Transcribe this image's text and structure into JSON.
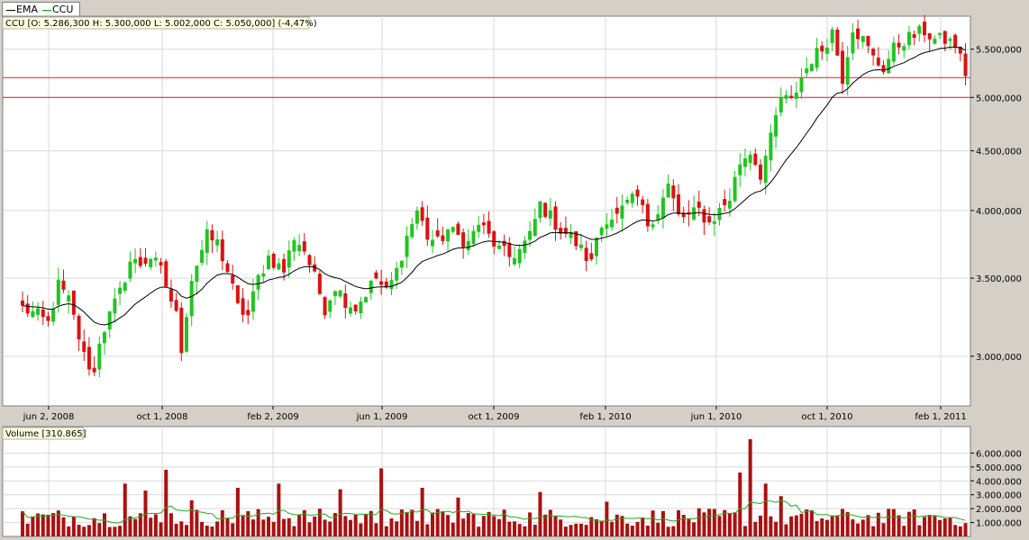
{
  "legend": {
    "items": [
      {
        "label": "EMA",
        "color": "#000000"
      },
      {
        "label": "CCU",
        "color": "#00b000"
      }
    ]
  },
  "price_panel": {
    "info": "CCU [O: 5.286,300  H: 5.300,000  L: 5.002,000  C: 5.050,000] (-4,47%)"
  },
  "volume_panel": {
    "info": "Volume [310.865]"
  },
  "colors": {
    "up": "#22c422",
    "down": "#dd1111",
    "ema": "#000000",
    "volume_bar": "#aa1111",
    "volume_ma": "#22aa22",
    "hline": "#dd2222",
    "grid": "#d9d9d9",
    "panel_bg": "#ffffff"
  },
  "chart_data": [
    {
      "type": "candlestick",
      "name": "CCU",
      "x_tick_labels": [
        "jun 2, 2008",
        "oct 1, 2008",
        "feb 2, 2009",
        "jun 1, 2009",
        "oct 1, 2009",
        "feb 1, 2010",
        "jun 1, 2010",
        "oct 1, 2010",
        "feb 1, 2011"
      ],
      "y_tick_labels": [
        "3.000,000",
        "3.500,000",
        "4.000,000",
        "4.500,000",
        "5.000,000",
        "5.500,000"
      ],
      "y_ticks": [
        3000000,
        3500000,
        4000000,
        4500000,
        5000000,
        5500000
      ],
      "y_scale": "log",
      "ylim": [
        2720000,
        5870000
      ],
      "horizontal_lines": [
        5200000,
        5000000
      ],
      "close_keyframes": [
        [
          0,
          3300000
        ],
        [
          3,
          3250000
        ],
        [
          5,
          3200000
        ],
        [
          7,
          3450000
        ],
        [
          9,
          3350000
        ],
        [
          12,
          3000000
        ],
        [
          14,
          2900000
        ],
        [
          15,
          3100000
        ],
        [
          17,
          3250000
        ],
        [
          19,
          3400000
        ],
        [
          21,
          3620000
        ],
        [
          23,
          3600000
        ],
        [
          25,
          3650000
        ],
        [
          27,
          3550000
        ],
        [
          30,
          3250000
        ],
        [
          31,
          3050000
        ],
        [
          33,
          3500000
        ],
        [
          36,
          3800000
        ],
        [
          38,
          3750000
        ],
        [
          40,
          3550000
        ],
        [
          42,
          3300000
        ],
        [
          44,
          3250000
        ],
        [
          46,
          3500000
        ],
        [
          48,
          3650000
        ],
        [
          51,
          3550000
        ],
        [
          53,
          3800000
        ],
        [
          55,
          3700000
        ],
        [
          57,
          3500000
        ],
        [
          59,
          3300000
        ],
        [
          61,
          3450000
        ],
        [
          63,
          3350000
        ],
        [
          65,
          3300000
        ],
        [
          67,
          3400000
        ],
        [
          69,
          3500000
        ],
        [
          71,
          3400000
        ],
        [
          73,
          3550000
        ],
        [
          75,
          3800000
        ],
        [
          77,
          4000000
        ],
        [
          79,
          3800000
        ],
        [
          81,
          3750000
        ],
        [
          83,
          3850000
        ],
        [
          85,
          3800000
        ],
        [
          87,
          3750000
        ],
        [
          89,
          3900000
        ],
        [
          91,
          3800000
        ],
        [
          93,
          3700000
        ],
        [
          95,
          3650000
        ],
        [
          97,
          3700000
        ],
        [
          99,
          3800000
        ],
        [
          101,
          4050000
        ],
        [
          103,
          3950000
        ],
        [
          105,
          3850000
        ],
        [
          107,
          3800000
        ],
        [
          109,
          3700000
        ],
        [
          111,
          3600000
        ],
        [
          112,
          3800000
        ],
        [
          114,
          3950000
        ],
        [
          116,
          3950000
        ],
        [
          118,
          4050000
        ],
        [
          120,
          4100000
        ],
        [
          122,
          3900000
        ],
        [
          124,
          4000000
        ],
        [
          126,
          4200000
        ],
        [
          128,
          3950000
        ],
        [
          130,
          3950000
        ],
        [
          132,
          4000000
        ],
        [
          134,
          3900000
        ],
        [
          136,
          4000000
        ],
        [
          138,
          4100000
        ],
        [
          140,
          4400000
        ],
        [
          142,
          4500000
        ],
        [
          144,
          4300000
        ],
        [
          146,
          4600000
        ],
        [
          148,
          5000000
        ],
        [
          150,
          4950000
        ],
        [
          152,
          5200000
        ],
        [
          154,
          5400000
        ],
        [
          156,
          5500000
        ],
        [
          158,
          5700000
        ],
        [
          160,
          5200000
        ],
        [
          162,
          5750000
        ],
        [
          164,
          5600000
        ],
        [
          166,
          5400000
        ],
        [
          168,
          5300000
        ],
        [
          170,
          5500000
        ],
        [
          172,
          5600000
        ],
        [
          174,
          5650000
        ],
        [
          176,
          5700000
        ],
        [
          178,
          5600000
        ],
        [
          180,
          5600000
        ],
        [
          182,
          5550000
        ],
        [
          183,
          5400000
        ],
        [
          184,
          5250000
        ],
        [
          185,
          5050000
        ]
      ],
      "last_candle": {
        "open": 5286300,
        "high": 5300000,
        "low": 5002000,
        "close": 5050000
      },
      "overlay": {
        "name": "EMA",
        "type": "line"
      }
    },
    {
      "type": "bar",
      "name": "Volume",
      "y_tick_labels": [
        "1.000.000",
        "2.000.000",
        "3.000.000",
        "4.000.000",
        "5.000.000",
        "6.000.000"
      ],
      "y_ticks": [
        1000000,
        2000000,
        3000000,
        4000000,
        5000000,
        6000000
      ],
      "ylim": [
        0,
        7000000
      ],
      "base_level": 1500000,
      "last_value": 310865,
      "spikes": [
        [
          20,
          3800000
        ],
        [
          24,
          3300000
        ],
        [
          28,
          4800000
        ],
        [
          33,
          2600000
        ],
        [
          42,
          3500000
        ],
        [
          50,
          3800000
        ],
        [
          62,
          3400000
        ],
        [
          70,
          4900000
        ],
        [
          78,
          3500000
        ],
        [
          85,
          2800000
        ],
        [
          101,
          3200000
        ],
        [
          114,
          2500000
        ],
        [
          140,
          4600000
        ],
        [
          142,
          7000000
        ],
        [
          145,
          3800000
        ],
        [
          148,
          2900000
        ]
      ],
      "overlay": {
        "name": "MA",
        "type": "line"
      }
    }
  ]
}
